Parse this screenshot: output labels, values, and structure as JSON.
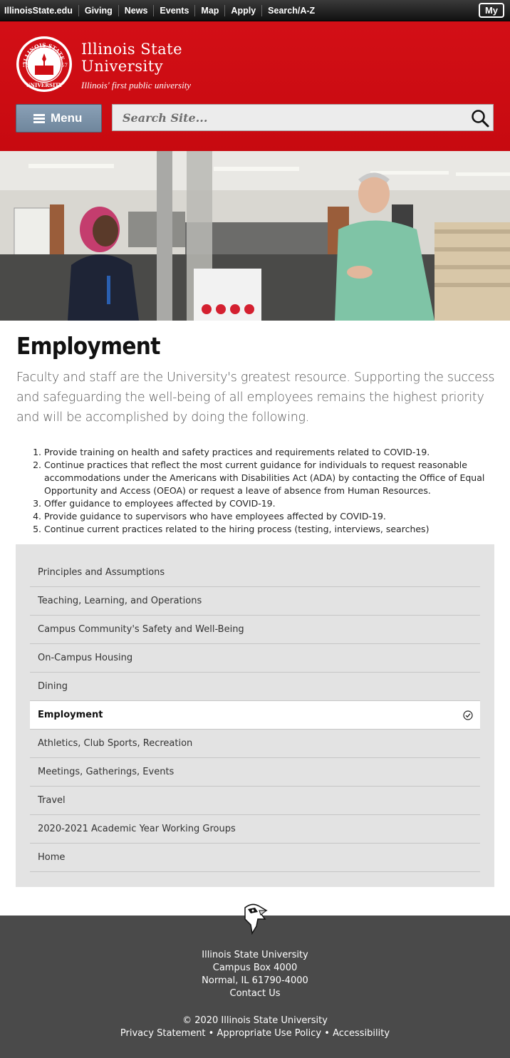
{
  "utility_nav": {
    "items": [
      "IllinoisState.edu",
      "Giving",
      "News",
      "Events",
      "Map",
      "Apply",
      "Search/A-Z"
    ],
    "my_label": "My"
  },
  "header": {
    "university_line1": "Illinois State",
    "university_line2": "University",
    "tagline": "Illinois' first public university",
    "menu_label": "Menu",
    "search_placeholder": "Search Site...",
    "brand_color": "#cf0e15"
  },
  "main": {
    "title": "Employment",
    "intro": "Faculty and staff are the University's greatest resource. Supporting the success and safeguarding the well-being of all employees remains the highest priority and will be accomplished by doing the following.",
    "steps": [
      "Provide training on health and safety practices and requirements related to COVID-19.",
      "Continue practices that reflect the most current guidance for individuals to request reasonable accommodations under the Americans with Disabilities Act (ADA) by contacting the Office of Equal Opportunity and Access (OEOA) or request a leave of absence from Human Resources.",
      "Offer guidance to employees affected by COVID-19.",
      "Provide guidance to supervisors who have employees affected by COVID-19.",
      "Continue current practices related to the hiring process (testing, interviews, searches)"
    ]
  },
  "section_nav": {
    "items": [
      "Principles and Assumptions",
      "Teaching, Learning, and Operations",
      "Campus Community's Safety and Well-Being",
      "On-Campus Housing",
      "Dining",
      "Employment",
      "Athletics, Club Sports, Recreation",
      "Meetings, Gatherings, Events",
      "Travel",
      "2020-2021 Academic Year Working Groups",
      "Home"
    ],
    "active": "Employment"
  },
  "footer": {
    "name": "Illinois State University",
    "box": "Campus Box 4000",
    "city": "Normal, IL 61790-4000",
    "contact": "Contact Us",
    "copyright": "© 2020 Illinois State University",
    "privacy": "Privacy Statement",
    "policy": "Appropriate Use Policy",
    "accessibility": "Accessibility",
    "separator": "•"
  }
}
